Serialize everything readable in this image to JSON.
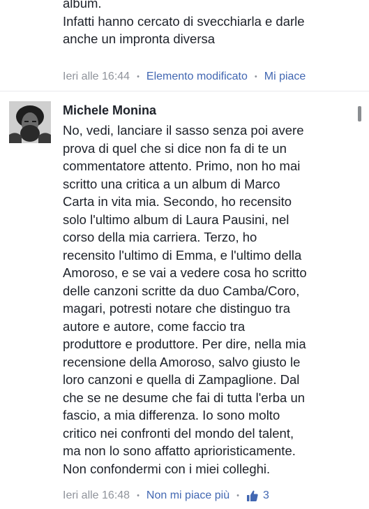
{
  "previous_comment": {
    "lines": [
      "album.",
      "Infatti hanno cercato di svecchiarla e darle",
      "anche un impronta diversa"
    ],
    "time": "Ieri alle 16:44",
    "edited_label": "Elemento modificato",
    "like_label": "Mi piace"
  },
  "main_comment": {
    "author": "Michele Monina",
    "lines": [
      "No, vedi, lanciare il sasso senza poi avere",
      "prova di quel che si dice non fa di te un",
      "commentatore attento. Primo, non ho mai",
      "scritto una critica a un album di Marco",
      "Carta in vita mia. Secondo, ho recensito",
      "solo l'ultimo album di Laura Pausini, nel",
      "corso della mia carriera. Terzo, ho",
      "recensito l'ultimo di Emma, e l'ultimo della",
      "Amoroso, e se vai a vedere cosa ho scritto",
      "delle canzoni scritte da duo Camba/Coro,",
      "magari, potresti notare che distinguo tra",
      "autore e autore, come faccio tra",
      "produttore e produttore. Per dire, nella mia",
      "recensione della Amoroso, salvo giusto le",
      "loro canzoni e quella di Zampaglione. Dal",
      "che se ne desume che fai di tutta l'erba un",
      "fascio, a mia differenza. Io sono molto",
      "critico nei confronti del mondo del talent,",
      "ma non lo sono affatto aprioristicamente.",
      "Non confondermi con i miei colleghi."
    ],
    "time": "Ieri alle 16:48",
    "unlike_label": "Non mi piace più",
    "like_count": "3",
    "like_icon": "thumbs-up-icon"
  },
  "colors": {
    "link": "#4267b2",
    "meta": "#90949c",
    "text": "#1d2129"
  }
}
